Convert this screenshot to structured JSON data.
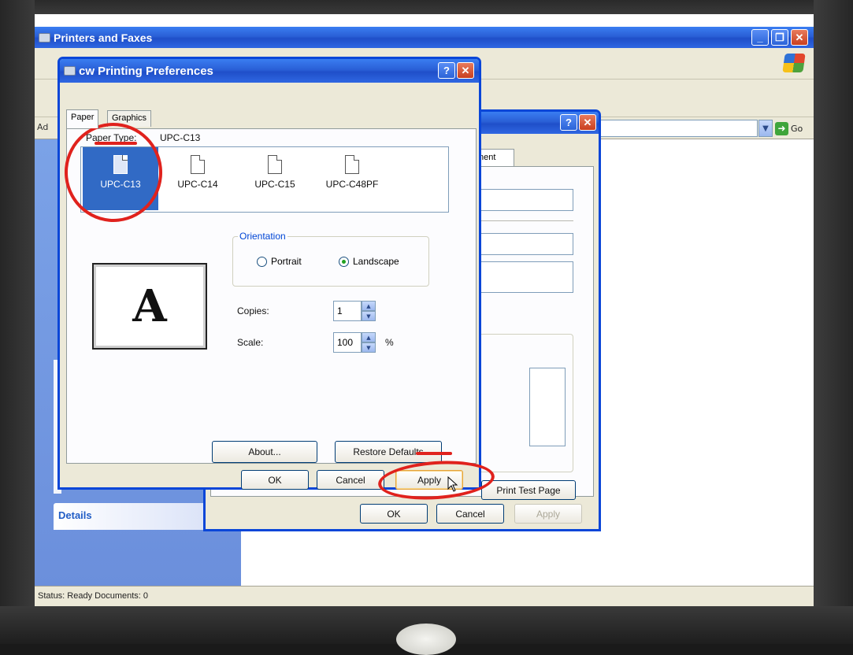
{
  "explorer": {
    "title": "Printers and Faxes",
    "address_label": "Ad",
    "go_label": "Go",
    "details_label": "Details",
    "status": "Status: Ready Documents: 0",
    "icons": {
      "app": "printer-folder-icon",
      "minimize": "minimize-icon",
      "restore": "restore-icon",
      "close": "close-icon",
      "windows_logo": "windows-logo-icon",
      "go": "go-arrow-icon"
    }
  },
  "properties": {
    "tab_label": "nent",
    "print_test_page": "Print Test Page",
    "ok": "OK",
    "cancel": "Cancel",
    "apply": "Apply"
  },
  "preferences": {
    "title": "cw Printing Preferences",
    "tabs": [
      "Paper",
      "Graphics"
    ],
    "paper_type_label": "Paper Type:",
    "paper_type_value": "UPC-C13",
    "paper_sizes": [
      {
        "label": "UPC-C13",
        "selected": true
      },
      {
        "label": "UPC-C14",
        "selected": false
      },
      {
        "label": "UPC-C15",
        "selected": false
      },
      {
        "label": "UPC-C48PF",
        "selected": false
      }
    ],
    "orientation": {
      "title": "Orientation",
      "portrait": "Portrait",
      "landscape": "Landscape",
      "selected": "landscape"
    },
    "preview_letter": "A",
    "copies": {
      "label": "Copies:",
      "value": "1"
    },
    "scale": {
      "label": "Scale:",
      "value": "100",
      "unit": "%"
    },
    "about": "About...",
    "restore_defaults": "Restore Defaults",
    "ok": "OK",
    "cancel": "Cancel",
    "apply": "Apply"
  },
  "colors": {
    "titlebar": "#2a5fd6",
    "dialog_face": "#ece9d8",
    "selection": "#316ac5",
    "annotation": "#e0221d"
  }
}
